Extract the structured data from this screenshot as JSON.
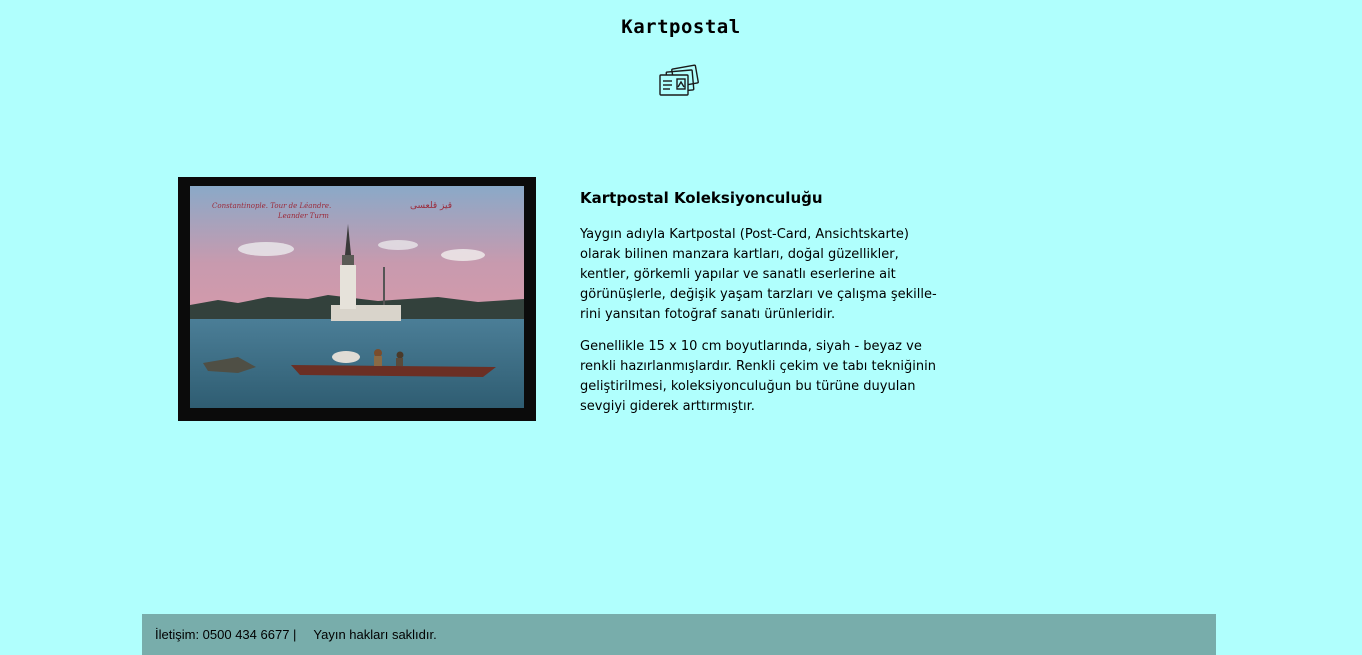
{
  "header": {
    "title": "Kartpostal",
    "logo_icon": "postcard-stack-icon"
  },
  "main": {
    "image": {
      "caption_latin": "Constantinople.   Tour de Léandre.",
      "caption_latin_2": "Leander Turm",
      "caption_arabic": "قيز قلعسى"
    },
    "heading": "Kartpostal Koleksiyonculuğu",
    "paragraphs": [
      "Yaygın adıyla Kartpostal (Post-Card, Ansichtskarte) olarak bilinen manzara kartları, doğal güzellikler, kentler, görkemli yapılar ve sanatlı eserlerine ait görünüşlerle, değişik yaşam tarzları ve çalışma şekille-rini yansıtan fotoğraf sanatı ürünleridir.",
      "Genellikle 15 x 10 cm boyutlarında, siyah - beyaz ve renkli hazırlanmışlardır. Renkli çekim ve tabı tekniğinin geliştirilmesi, koleksiyonculuğun bu türüne duyulan sevgiyi giderek arttırmıştır."
    ]
  },
  "footer": {
    "contact": "İletişim: 0500 434 6677 |",
    "copyright": "Yayın hakları saklıdır."
  },
  "colors": {
    "background": "#b0fffd",
    "footer": "#78adab"
  }
}
